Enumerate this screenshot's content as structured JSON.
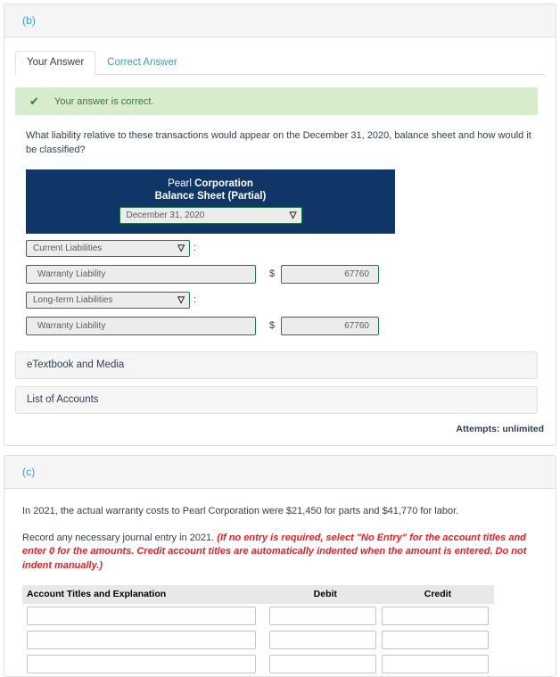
{
  "section_b": {
    "part_label": "(b)",
    "tabs": [
      {
        "label": "Your Answer",
        "active": true
      },
      {
        "label": "Correct Answer",
        "active": false
      }
    ],
    "alert": {
      "icon": "checkmark-icon",
      "glyph": "✔",
      "text": "Your answer is correct.",
      "bg_color": "#d6eccd",
      "text_color": "#3c763d"
    },
    "question": "What liability relative to these transactions would appear on the December 31, 2020, balance sheet and how would it be classified?",
    "balance_sheet": {
      "header_bg": "#103667",
      "company_plain": "Pearl",
      "company_bold": "Corporation",
      "subtitle": "Balance Sheet (Partial)",
      "date_select": {
        "value": "December 31, 2020",
        "caret": "⌄"
      },
      "rows": [
        {
          "classification_select": "Current Liabilities",
          "colon": ":",
          "account": "Warranty Liability",
          "currency": "$",
          "amount": "67760"
        },
        {
          "classification_select": "Long-term Liabilities",
          "colon": ":",
          "account": "Warranty Liability",
          "currency": "$",
          "amount": "67760"
        }
      ]
    },
    "buttons": [
      {
        "label": "eTextbook and Media"
      },
      {
        "label": "List of Accounts"
      }
    ],
    "attempts": "Attempts: unlimited"
  },
  "section_c": {
    "part_label": "(c)",
    "paragraph_1": "In 2021, the actual warranty costs to Pearl Corporation were $21,450 for parts and $41,770 for labor.",
    "paragraph_2_plain": "Record any necessary journal entry in 2021. ",
    "paragraph_2_red": "(If no entry is required, select \"No Entry\" for the account titles and enter 0 for the amounts. Credit account titles are automatically indented when the amount is entered. Do not indent manually.)",
    "journal_table": {
      "columns": [
        "Account Titles and Explanation",
        "Debit",
        "Credit"
      ],
      "rows": [
        {
          "account": "",
          "debit": "",
          "credit": ""
        },
        {
          "account": "",
          "debit": "",
          "credit": ""
        },
        {
          "account": "",
          "debit": "",
          "credit": ""
        }
      ]
    }
  }
}
